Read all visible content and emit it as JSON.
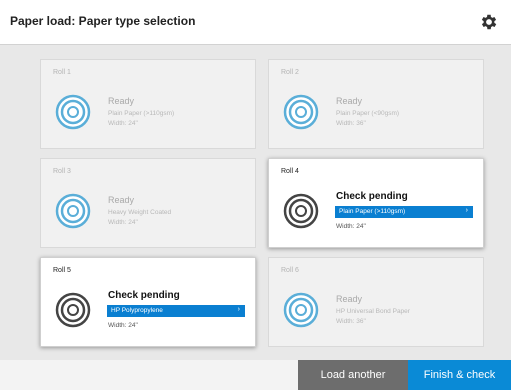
{
  "header": {
    "title": "Paper load: Paper type selection",
    "settings_icon": "gear-icon"
  },
  "rolls": [
    {
      "label": "Roll 1",
      "status": "Ready",
      "paper_type": "Plain Paper (>110gsm)",
      "width": "Width: 24\"",
      "active": false
    },
    {
      "label": "Roll 2",
      "status": "Ready",
      "paper_type": "Plain Paper (<90gsm)",
      "width": "Width: 36\"",
      "active": false
    },
    {
      "label": "Roll 3",
      "status": "Ready",
      "paper_type": "Heavy Weight Coated",
      "width": "Width: 24\"",
      "active": false
    },
    {
      "label": "Roll 4",
      "status": "Check pending",
      "paper_type": "Plain Paper (>110gsm)",
      "width": "Width: 24\"",
      "active": true
    },
    {
      "label": "Roll 5",
      "status": "Check pending",
      "paper_type": "HP Polypropylene",
      "width": "Width: 24\"",
      "active": true
    },
    {
      "label": "Roll 6",
      "status": "Ready",
      "paper_type": "HP Universal Bond Paper",
      "width": "Width: 36\"",
      "active": false
    }
  ],
  "footer": {
    "load_another": "Load another",
    "finish_check": "Finish & check"
  },
  "colors": {
    "accent": "#0a8ad6",
    "dropdown": "#0a7fd1",
    "secondary_button": "#6d6d6d",
    "spool_ready": "#5aaed8",
    "spool_pending": "#555555"
  }
}
